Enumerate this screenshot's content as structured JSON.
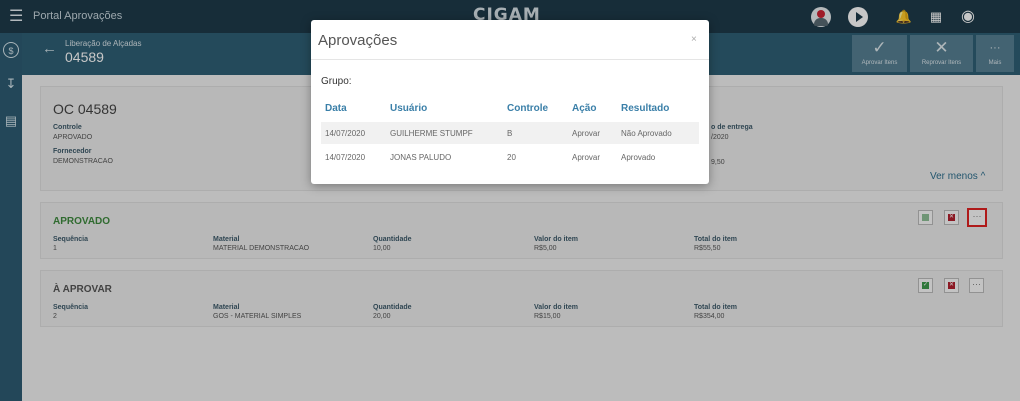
{
  "topbar": {
    "title": "Portal Aprovações",
    "logo": "CIGAM",
    "icons": [
      "menu-icon",
      "avatar-icon",
      "play-icon",
      "bell-icon",
      "grid-icon",
      "user-icon"
    ]
  },
  "sidebar": {
    "icons": [
      "dollar-icon",
      "cart-icon",
      "clipboard-icon"
    ]
  },
  "page": {
    "subtitle": "Liberação de Alçadas",
    "number": "04589"
  },
  "actions": {
    "approve": "Aprovar Itens",
    "reject": "Reprovar Itens",
    "more": "Mais"
  },
  "order": {
    "title": "OC 04589",
    "controle_label": "Controle",
    "controle_value": "APROVADO",
    "fornecedor_label": "Fornecedor",
    "fornecedor_value": "DEMONSTRACAO",
    "entrega_label_partial": "o de entrega",
    "entrega_value_partial": "/2020",
    "total_partial": "9,50",
    "ver_menos": "Ver menos ^"
  },
  "items": [
    {
      "status": "APROVADO",
      "status_color": "#3e8a3e",
      "sequencia_label": "Sequência",
      "sequencia": "1",
      "material_label": "Material",
      "material": "MATERIAL DEMONSTRACAO",
      "quantidade_label": "Quantidade",
      "quantidade": "10,00",
      "valor_label": "Valor do item",
      "valor": "R$5,00",
      "total_label": "Total do item",
      "total": "R$55,50"
    },
    {
      "status": "À APROVAR",
      "status_color": "#555555",
      "sequencia_label": "Sequência",
      "sequencia": "2",
      "material_label": "Material",
      "material": "GOS - MATERIAL SIMPLES",
      "quantidade_label": "Quantidade",
      "quantidade": "20,00",
      "valor_label": "Valor do item",
      "valor": "R$15,00",
      "total_label": "Total do item",
      "total": "R$354,00"
    }
  ],
  "modal": {
    "title": "Aprovações",
    "close": "×",
    "grupo_label": "Grupo:",
    "columns": [
      "Data",
      "Usuário",
      "Controle",
      "Ação",
      "Resultado"
    ],
    "rows": [
      [
        "14/07/2020",
        "GUILHERME STUMPF",
        "B",
        "Aprovar",
        "Não Aprovado"
      ],
      [
        "14/07/2020",
        "JONAS PALUDO",
        "20",
        "Aprovar",
        "Aprovado"
      ]
    ]
  }
}
